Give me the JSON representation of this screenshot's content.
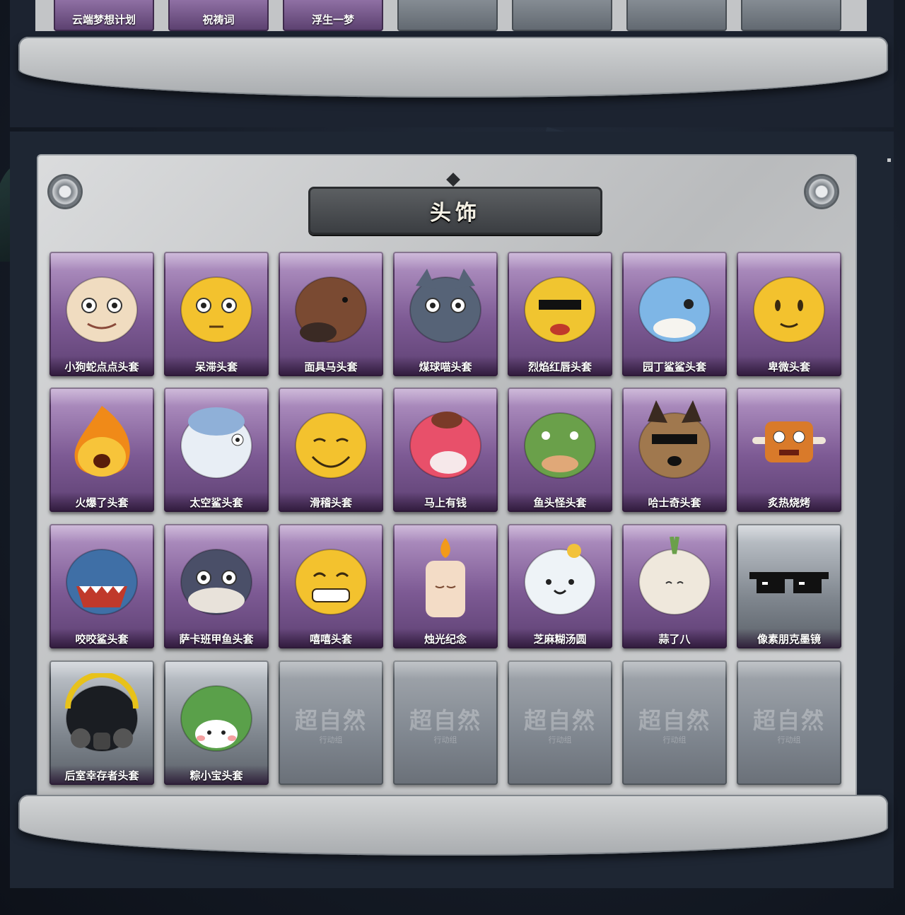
{
  "top_row": {
    "items": [
      "云端梦想计划",
      "祝祷词",
      "浮生一梦",
      "",
      "",
      "",
      ""
    ]
  },
  "section": {
    "title": "头饰"
  },
  "cards": [
    {
      "label": "小狗蛇点点头套",
      "rarity": "purple",
      "icon": "snake-dog-head-icon"
    },
    {
      "label": "呆滞头套",
      "rarity": "purple",
      "icon": "blank-face-head-icon"
    },
    {
      "label": "面具马头套",
      "rarity": "purple",
      "icon": "horse-mask-icon"
    },
    {
      "label": "煤球喵头套",
      "rarity": "purple",
      "icon": "cat-head-icon"
    },
    {
      "label": "烈焰红唇头套",
      "rarity": "purple",
      "icon": "yellow-mouse-head-icon"
    },
    {
      "label": "园丁鲨鲨头套",
      "rarity": "purple",
      "icon": "shark-gardener-icon"
    },
    {
      "label": "卑微头套",
      "rarity": "purple",
      "icon": "humble-face-head-icon"
    },
    {
      "label": "火爆了头套",
      "rarity": "purple",
      "icon": "fire-head-icon"
    },
    {
      "label": "太空鲨头套",
      "rarity": "purple",
      "icon": "space-shark-icon"
    },
    {
      "label": "滑稽头套",
      "rarity": "purple",
      "icon": "funny-face-head-icon"
    },
    {
      "label": "马上有钱",
      "rarity": "purple",
      "icon": "pink-horse-icon"
    },
    {
      "label": "鱼头怪头套",
      "rarity": "purple",
      "icon": "fish-head-icon"
    },
    {
      "label": "哈士奇头套",
      "rarity": "purple",
      "icon": "husky-head-icon"
    },
    {
      "label": "炙热烧烤",
      "rarity": "purple",
      "icon": "bbq-meat-icon"
    },
    {
      "label": "咬咬鲨头套",
      "rarity": "purple",
      "icon": "biting-shark-icon"
    },
    {
      "label": "萨卡班甲鱼头套",
      "rarity": "purple",
      "icon": "sacabambaspis-icon"
    },
    {
      "label": "嘻嘻头套",
      "rarity": "purple",
      "icon": "grin-face-head-icon"
    },
    {
      "label": "烛光纪念",
      "rarity": "purple",
      "icon": "candle-icon"
    },
    {
      "label": "芝麻糊汤圆",
      "rarity": "purple",
      "icon": "tangyuan-icon"
    },
    {
      "label": "蒜了八",
      "rarity": "purple",
      "icon": "garlic-icon"
    },
    {
      "label": "像素朋克墨镜",
      "rarity": "gray",
      "icon": "pixel-sunglasses-icon"
    },
    {
      "label": "后室幸存者头套",
      "rarity": "gray",
      "icon": "gas-mask-helmet-icon"
    },
    {
      "label": "粽小宝头套",
      "rarity": "gray",
      "icon": "zongzi-icon"
    }
  ],
  "empty_slot": {
    "watermark": "超自然",
    "watermark_sub": "行动组",
    "count": 5
  },
  "colors": {
    "purple_card": "#7d5a94",
    "gray_card": "#7f868e",
    "panel": "#c7c9cb",
    "background": "#151b26"
  }
}
